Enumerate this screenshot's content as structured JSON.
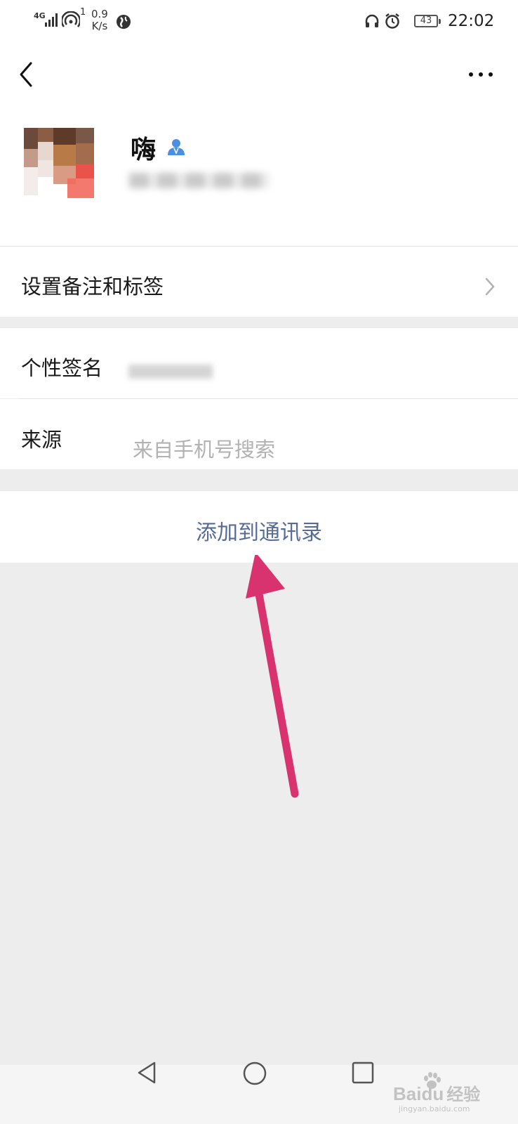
{
  "status_bar": {
    "network": "4G",
    "network_sub": "1",
    "speed_value": "0.9",
    "speed_unit": "K/s",
    "battery": "43",
    "time": "22:02"
  },
  "header": {
    "back_icon": "chevron-left-icon",
    "more_icon": "more-dots-icon"
  },
  "profile": {
    "name": "嗨",
    "verify_icon": "contact-person-icon"
  },
  "rows": {
    "remarks_label": "设置备注和标签",
    "signature_label": "个性签名",
    "source_label": "来源",
    "source_value": "来自手机号搜索"
  },
  "actions": {
    "add_contact_label": "添加到通讯录"
  },
  "colors": {
    "accent_link": "#576b95",
    "arrow": "#d8336f",
    "background": "#ededed"
  },
  "watermark": {
    "brand": "Baidu",
    "product": "经验",
    "url": "jingyan.baidu.com"
  }
}
